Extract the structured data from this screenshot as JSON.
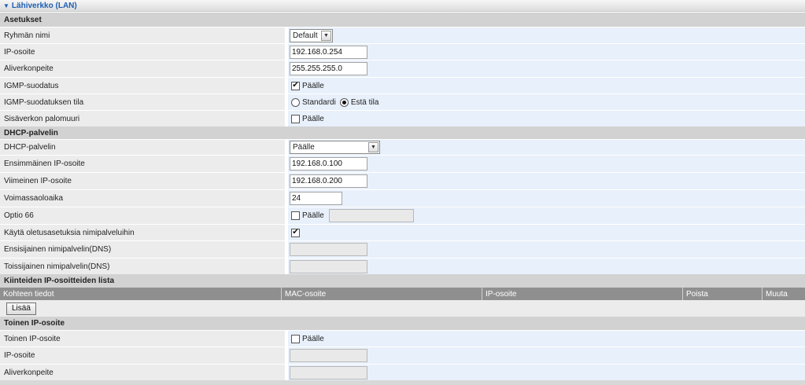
{
  "header": {
    "title": "Lähiverkko (LAN)"
  },
  "settings": {
    "section_title": "Asetukset",
    "group_name": {
      "label": "Ryhmän nimi",
      "value": "Default"
    },
    "ip_address": {
      "label": "IP-osoite",
      "value": "192.168.0.254"
    },
    "subnet_mask": {
      "label": "Aliverkonpeite",
      "value": "255.255.255.0"
    },
    "igmp_snooping": {
      "label": "IGMP-suodatus",
      "option_label": "Päälle",
      "checked": true
    },
    "igmp_mode": {
      "label": "IGMP-suodatuksen tila",
      "option_standard": "Standardi",
      "option_blocking": "Estä tila",
      "selected": "Estä tila"
    },
    "lan_firewall": {
      "label": "Sisäverkon palomuuri",
      "option_label": "Päälle",
      "checked": false
    }
  },
  "dhcp": {
    "section_title": "DHCP-palvelin",
    "server": {
      "label": "DHCP-palvelin",
      "value": "Päälle"
    },
    "first_ip": {
      "label": "Ensimmäinen IP-osoite",
      "value": "192.168.0.100"
    },
    "last_ip": {
      "label": "Viimeinen IP-osoite",
      "value": "192.168.0.200"
    },
    "lease_time": {
      "label": "Voimassaoloaika",
      "value": "24"
    },
    "option66": {
      "label": "Optio 66",
      "option_label": "Päälle",
      "checked": false,
      "value": ""
    },
    "default_dns": {
      "label": "Käytä oletusasetuksia nimipalveluihin",
      "checked": true
    },
    "primary_dns": {
      "label": "Ensisijainen nimipalvelin(DNS)",
      "value": ""
    },
    "secondary_dns": {
      "label": "Toissijainen nimipalvelin(DNS)",
      "value": ""
    }
  },
  "static_list": {
    "section_title": "Kiinteiden IP-osoitteiden lista",
    "columns": [
      "Kohteen tiedot",
      "MAC-osoite",
      "IP-osoite",
      "Poista",
      "Muuta"
    ],
    "add_label": "Lisää"
  },
  "secondary_ip": {
    "section_title": "Toinen IP-osoite",
    "enable": {
      "label": "Toinen IP-osoite",
      "option_label": "Päälle",
      "checked": false
    },
    "ip_address": {
      "label": "IP-osoite",
      "value": ""
    },
    "subnet_mask": {
      "label": "Aliverkonpeite",
      "value": ""
    }
  }
}
